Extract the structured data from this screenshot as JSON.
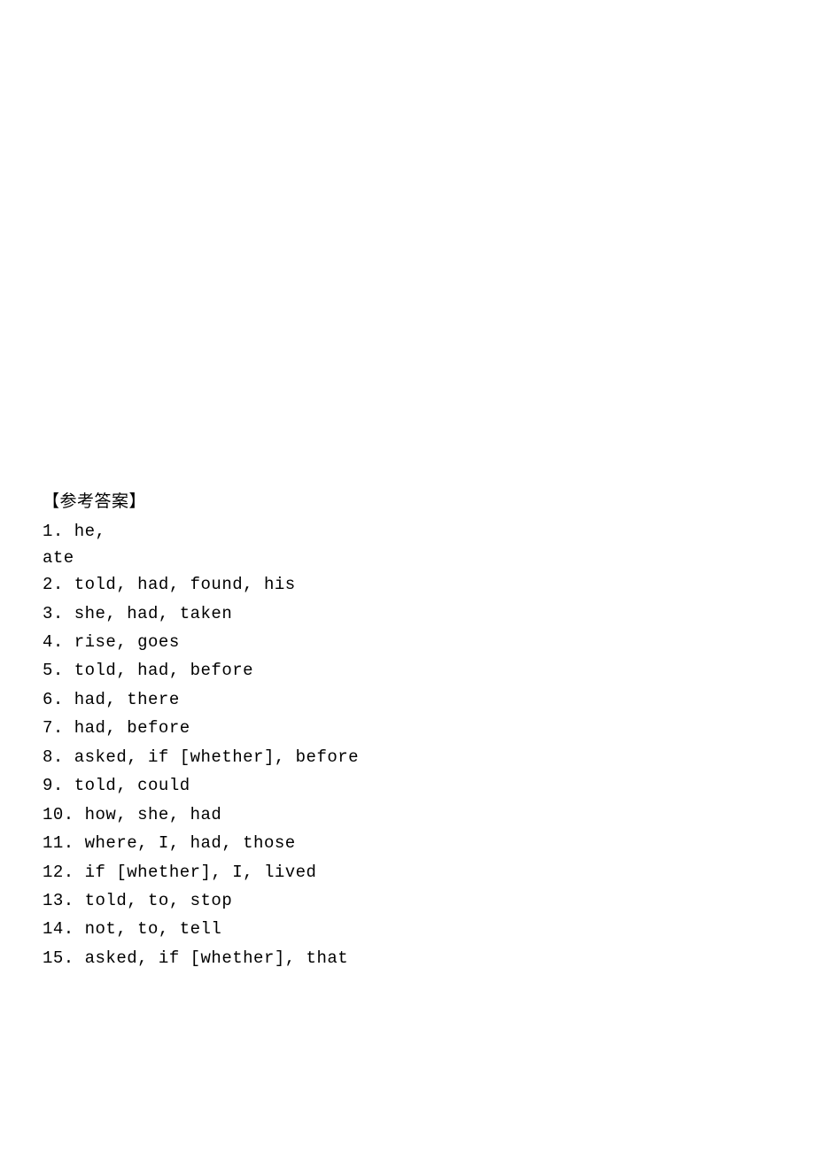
{
  "heading": "【参考答案】",
  "answers": [
    {
      "num": "1",
      "text": "he,",
      "wrap": "ate"
    },
    {
      "num": "2",
      "text": "told, had, found, his"
    },
    {
      "num": "3",
      "text": "she, had, taken"
    },
    {
      "num": "4",
      "text": "rise, goes"
    },
    {
      "num": "5",
      "text": "told, had, before"
    },
    {
      "num": "6",
      "text": "had, there"
    },
    {
      "num": "7",
      "text": "had, before"
    },
    {
      "num": "8",
      "text": "asked, if [whether], before"
    },
    {
      "num": "9",
      "text": "told, could"
    },
    {
      "num": "10",
      "text": "how, she, had"
    },
    {
      "num": "11",
      "text": "where, I, had, those"
    },
    {
      "num": "12",
      "text": "if [whether], I, lived"
    },
    {
      "num": "13",
      "text": "told, to, stop"
    },
    {
      "num": "14",
      "text": "not, to, tell"
    },
    {
      "num": "15",
      "text": "asked, if [whether], that"
    }
  ]
}
